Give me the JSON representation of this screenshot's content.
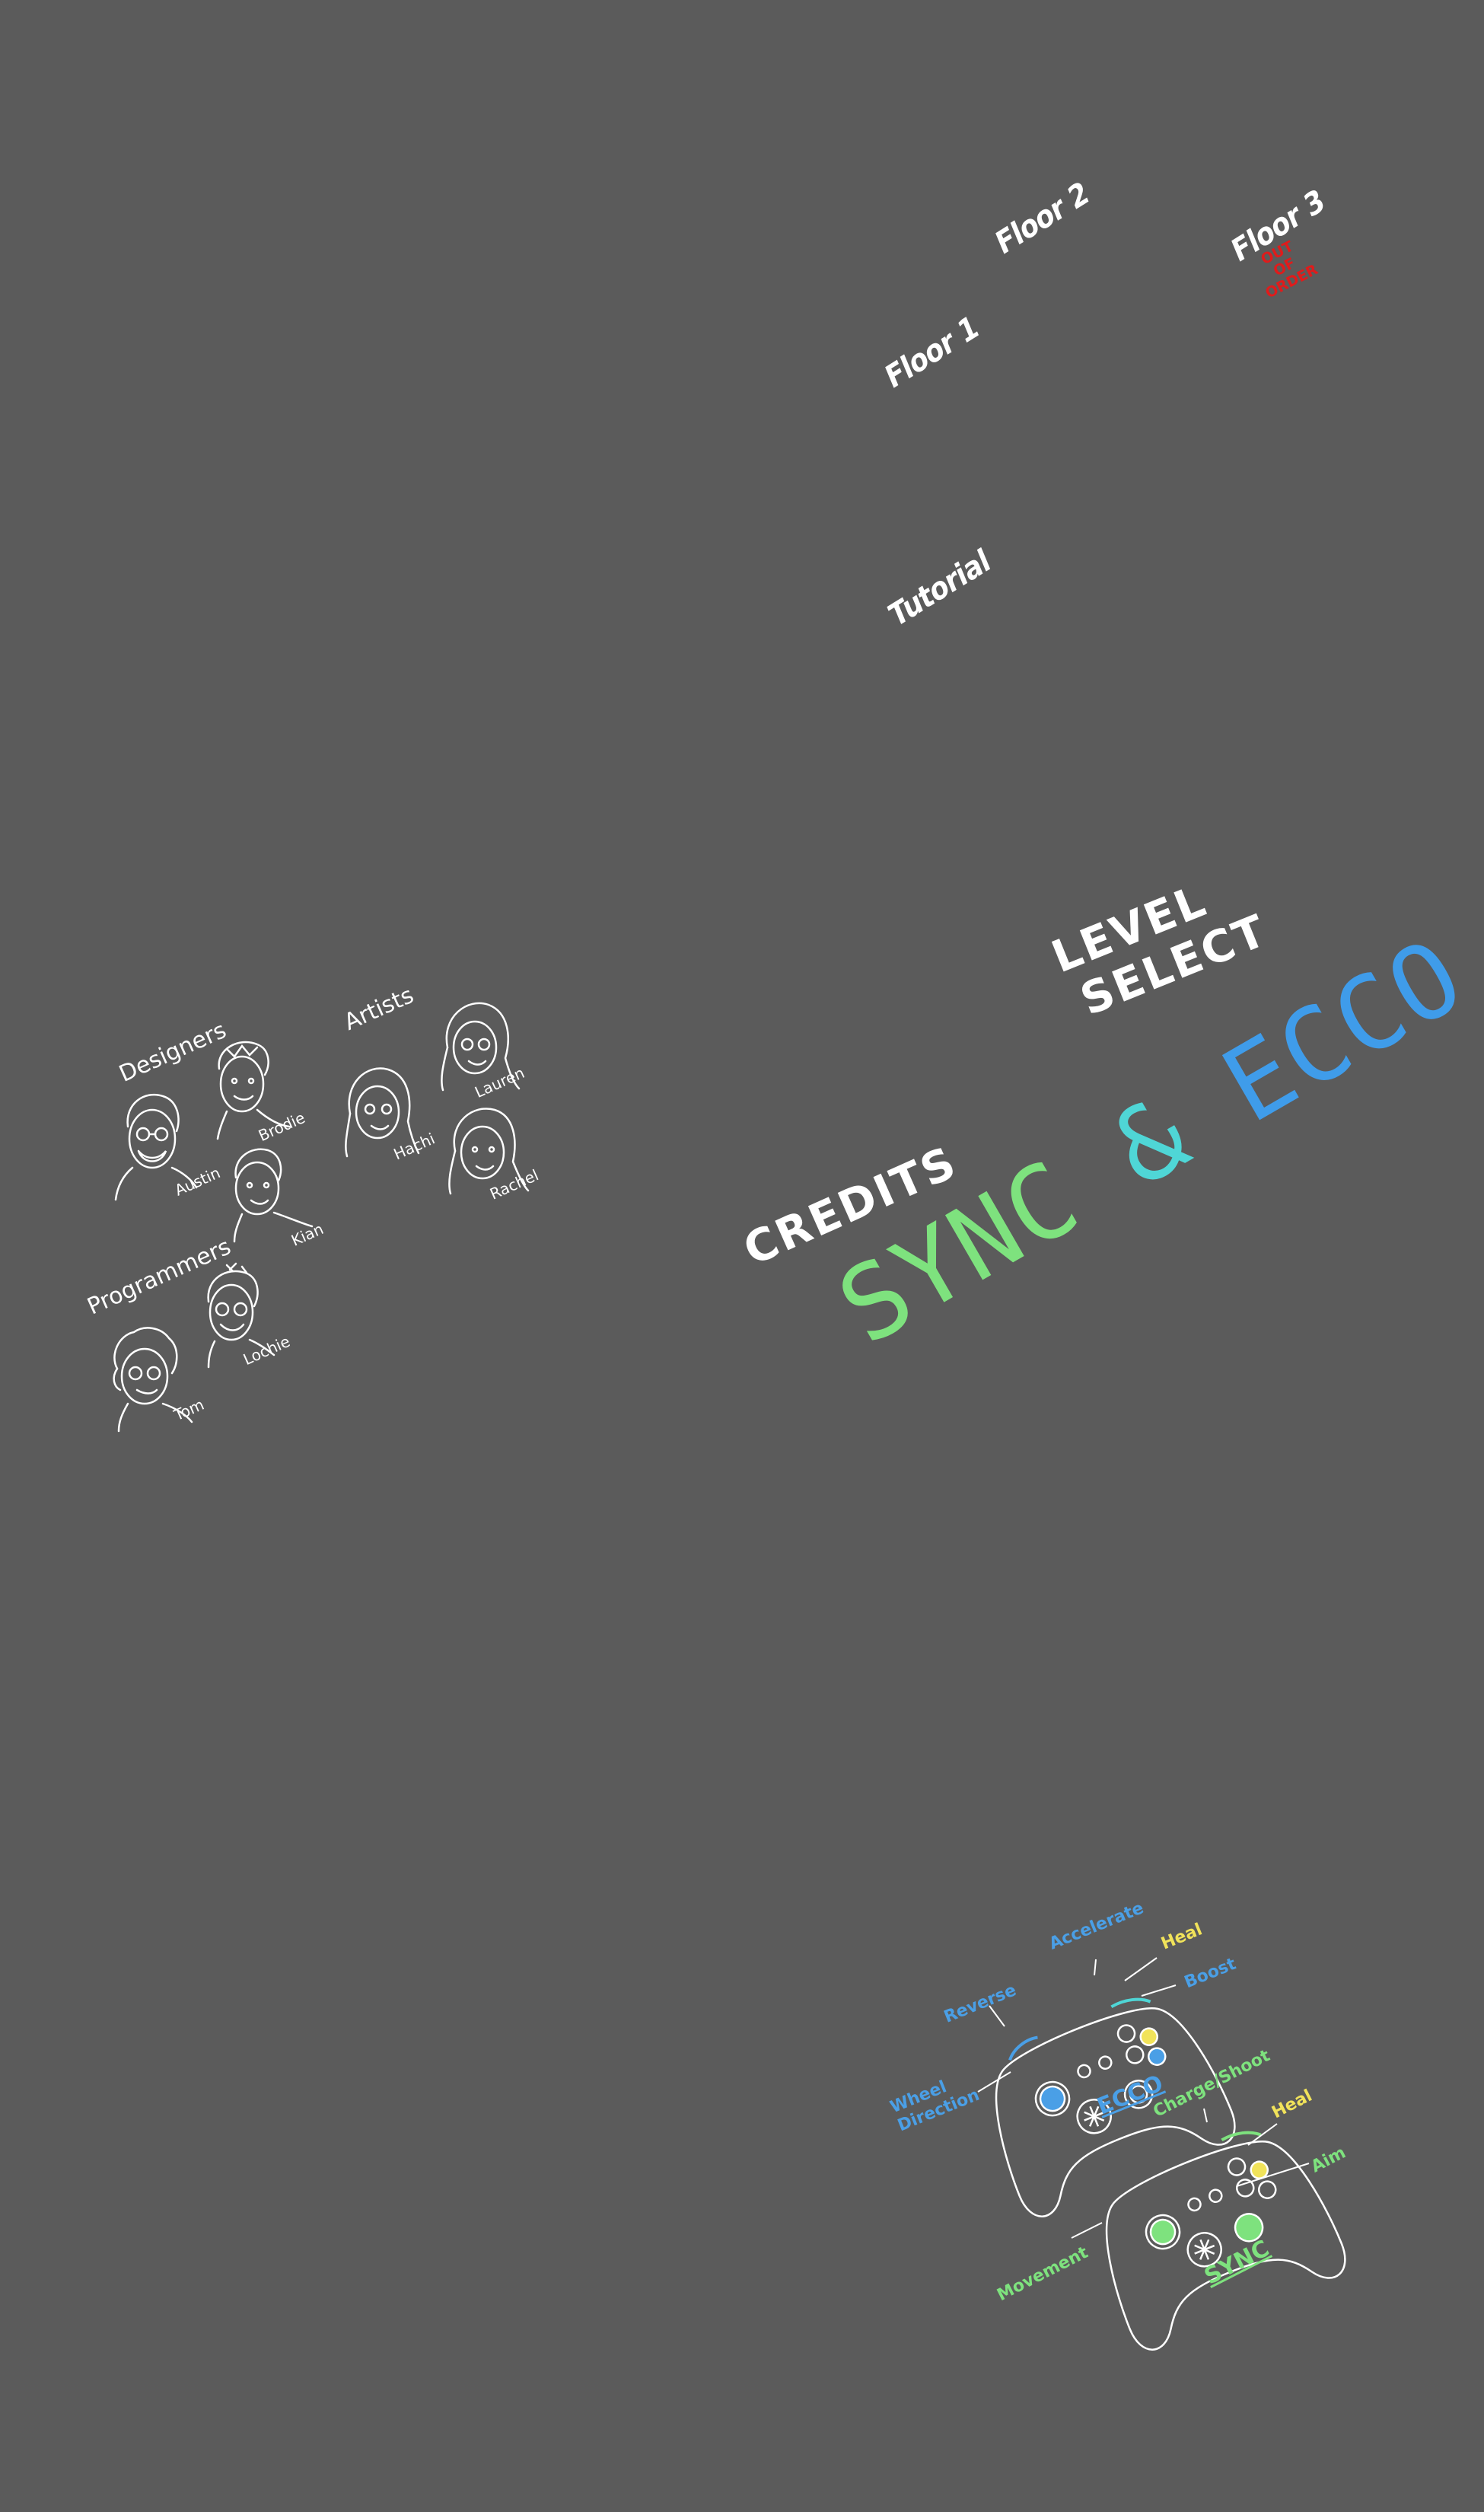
{
  "level_select": {
    "heading_line1": "LEVEL",
    "heading_line2": "SELECT",
    "tutorial": "Tutorial",
    "floor1": "Floor 1",
    "floor2": "Floor 2",
    "floor3": "Floor 3",
    "floor3_badge": "OUT OF ORDER"
  },
  "menu": {
    "credits": "CREDITS"
  },
  "title": {
    "sync": "SYNC",
    "amp": "&",
    "ecco": "ECCO",
    "sync_color": "#7ee27e",
    "amp_color": "#4fd6d6",
    "ecco_color": "#3f9cea"
  },
  "credits": {
    "designers_heading": "Designers",
    "artists_heading": "Artists",
    "programmers_heading": "Programmers",
    "designers": [
      "Austin",
      "Brodie",
      "Kian"
    ],
    "artists": [
      "Hachi",
      "Lauren",
      "Rachel"
    ],
    "programmers": [
      "Tom",
      "Lochie"
    ]
  },
  "controls": {
    "ecco": {
      "name": "ECCO",
      "color": "#4a9fe6",
      "reverse": "Reverse",
      "accelerate": "Accelerate",
      "heal": "Heal",
      "boost": "Boost",
      "wheel_line1": "Wheel",
      "wheel_line2": "Direction"
    },
    "sync": {
      "name": "SYNC",
      "color": "#7ee27e",
      "charge_shoot": "Charge/Shoot",
      "heal": "Heal",
      "aim": "Aim",
      "movement": "Movement"
    },
    "heal_color": "#f1e35a",
    "badge_color": "#e01b1b"
  }
}
